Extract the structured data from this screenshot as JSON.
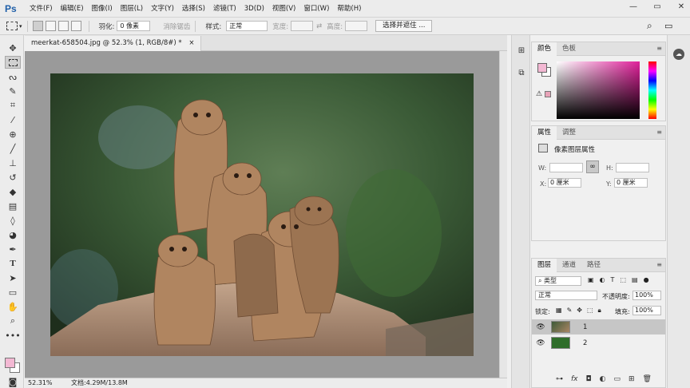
{
  "app": {
    "logo": "Ps"
  },
  "menu": [
    "文件(F)",
    "编辑(E)",
    "图像(I)",
    "图层(L)",
    "文字(Y)",
    "选择(S)",
    "滤镜(T)",
    "3D(D)",
    "视图(V)",
    "窗口(W)",
    "帮助(H)"
  ],
  "window_controls": {
    "minimize": "—",
    "restore": "▭",
    "close": "✕"
  },
  "options": {
    "feather_label": "羽化:",
    "feather_value": "0 像素",
    "antialias_label": "消除锯齿",
    "style_label": "样式:",
    "style_value": "正常",
    "width_label": "宽度:",
    "height_label": "高度:",
    "select_mask": "选择并遮住 ..."
  },
  "document": {
    "tab": "meerkat-658504.jpg @ 52.3% (1, RGB/8#) *",
    "close": "×"
  },
  "status": {
    "zoom": "52.31%",
    "doc_size": "文档:4.29M/13.8M"
  },
  "color_panel": {
    "tabs": [
      "颜色",
      "色板"
    ],
    "fg": "#f3b8d3",
    "bg": "#ffffff"
  },
  "properties_panel": {
    "tabs": [
      "属性",
      "调整"
    ],
    "title": "像素图层属性",
    "w_label": "W:",
    "h_label": "H:",
    "x_label": "X:",
    "x_value": "0 厘米",
    "y_label": "Y:",
    "y_value": "0 厘米"
  },
  "layers_panel": {
    "tabs": [
      "图层",
      "通道",
      "路径"
    ],
    "filter": "类型",
    "blend_mode": "正常",
    "opacity_label": "不透明度:",
    "opacity_value": "100%",
    "lock_label": "锁定:",
    "fill_label": "填充:",
    "fill_value": "100%",
    "layers": [
      {
        "name": "1",
        "selected": true
      },
      {
        "name": "2",
        "selected": false
      }
    ],
    "bottom_icons": [
      "link-icon",
      "fx-icon",
      "mask-icon",
      "adjustment-icon",
      "folder-icon",
      "new-layer-icon",
      "trash-icon"
    ]
  },
  "icons": {
    "search": "⌕",
    "workspace": "▭"
  }
}
